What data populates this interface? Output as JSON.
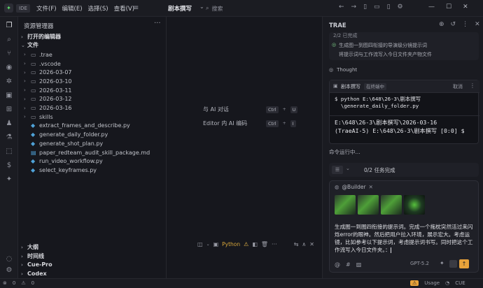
{
  "titlebar": {
    "ide_badge": "IDE",
    "menu": [
      "文件(F)",
      "编辑(E)",
      "选择(S)",
      "查看(V)"
    ],
    "project": "剧本撰写",
    "search_placeholder": "搜索"
  },
  "explorer": {
    "title": "资源管理器",
    "open_editors": "打开的编辑器",
    "files_label": "文件",
    "items": [
      {
        "name": ".trae",
        "type": "folder"
      },
      {
        "name": ".vscode",
        "type": "folder"
      },
      {
        "name": "2026-03-07",
        "type": "folder"
      },
      {
        "name": "2026-03-10",
        "type": "folder"
      },
      {
        "name": "2026-03-11",
        "type": "folder"
      },
      {
        "name": "2026-03-12",
        "type": "folder"
      },
      {
        "name": "2026-03-16",
        "type": "folder"
      },
      {
        "name": "skills",
        "type": "folder"
      },
      {
        "name": "extract_frames_and_describe.py",
        "type": "py"
      },
      {
        "name": "generate_daily_folder.py",
        "type": "py"
      },
      {
        "name": "generate_shot_plan.py",
        "type": "py"
      },
      {
        "name": "paper_redteam_audit_skill_package.md",
        "type": "md"
      },
      {
        "name": "run_video_workflow.py",
        "type": "py"
      },
      {
        "name": "select_keyframes.py",
        "type": "py"
      }
    ],
    "bottom_sections": [
      "大纲",
      "时间线",
      "Cue-Pro",
      "Codex"
    ]
  },
  "editor": {
    "hints": [
      {
        "label": "与 AI 对话",
        "keys": [
          "Ctrl",
          "U"
        ]
      },
      {
        "label": "Editor 内 AI 编码",
        "keys": [
          "Ctrl",
          "I"
        ]
      }
    ],
    "terminal_tab": "Python"
  },
  "panel": {
    "title": "TRAE",
    "task_status": "2/2 已完成",
    "tasks": [
      "生成图一到图四衔接的导演级分镜提示词",
      "将提示词与工作流写入今日文件夹产物文件"
    ],
    "thought_label": "Thought",
    "command": {
      "tag": "剧本撰写",
      "badge": "在终端中",
      "cancel": "取消",
      "code_lines": [
        "$ python E:\\648\\26-3\\剧本撰写",
        "  \\generate_daily_folder.py"
      ],
      "output_lines": [
        "E:\\648\\26-3\\剧本撰写\\2026-03-16",
        "(TraeAI-5) E:\\648\\26-3\\剧本撰写 [0:0] $"
      ]
    },
    "running_label": "命令运行中...",
    "progress_text": "0/2 任务完成",
    "input": {
      "agent": "@Builder",
      "prompt": "生成图一到图四衔接的提示词。完成一个拖枕突然活过来闪烁error的眼神。然后把用户拉入环境，展示宏大。考虑运镜，比如参考以下提示词，考虑提示词书写。同时把这个工作流写入今日文件夹。：",
      "model": "GPT-5.2"
    }
  },
  "statusbar": {
    "left": [
      "0",
      "0"
    ],
    "right": [
      "Usage",
      "CUE"
    ]
  }
}
